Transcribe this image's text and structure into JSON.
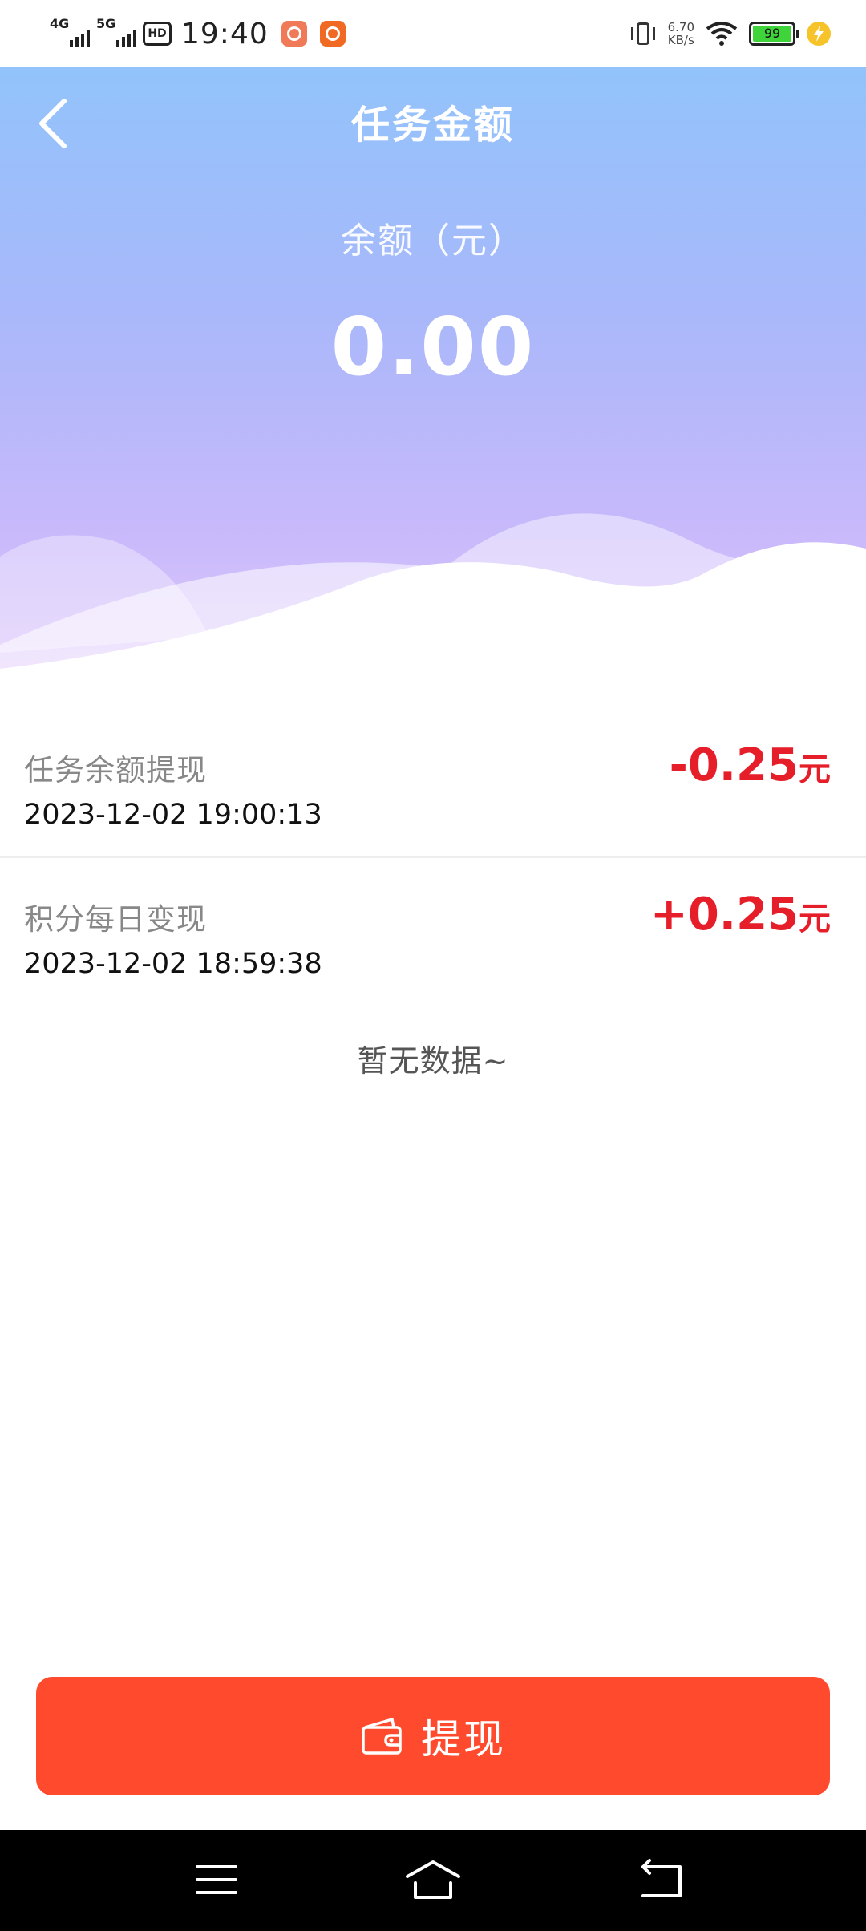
{
  "status_bar": {
    "network1": "4G",
    "network2": "5G",
    "hd_badge": "HD",
    "time": "19:40",
    "speed_value": "6.70",
    "speed_unit": "KB/s",
    "battery_level": "99"
  },
  "header": {
    "title": "任务金额",
    "back_icon": "chevron-left-icon"
  },
  "balance": {
    "label": "余额（元）",
    "value": "0.00"
  },
  "transactions": [
    {
      "name": "任务余额提现",
      "time": "2023-12-02 19:00:13",
      "amount": "-0.25",
      "unit": "元"
    },
    {
      "name": "积分每日变现",
      "time": "2023-12-02 18:59:38",
      "amount": "+0.25",
      "unit": "元"
    }
  ],
  "empty_text": "暂无数据~",
  "withdraw_button": {
    "label": "提现",
    "icon": "wallet-icon"
  },
  "colors": {
    "accent": "#ff4a2d",
    "amount": "#e61e2a",
    "gradient_top": "#92c3fb",
    "gradient_bottom": "#e0c8fb"
  }
}
